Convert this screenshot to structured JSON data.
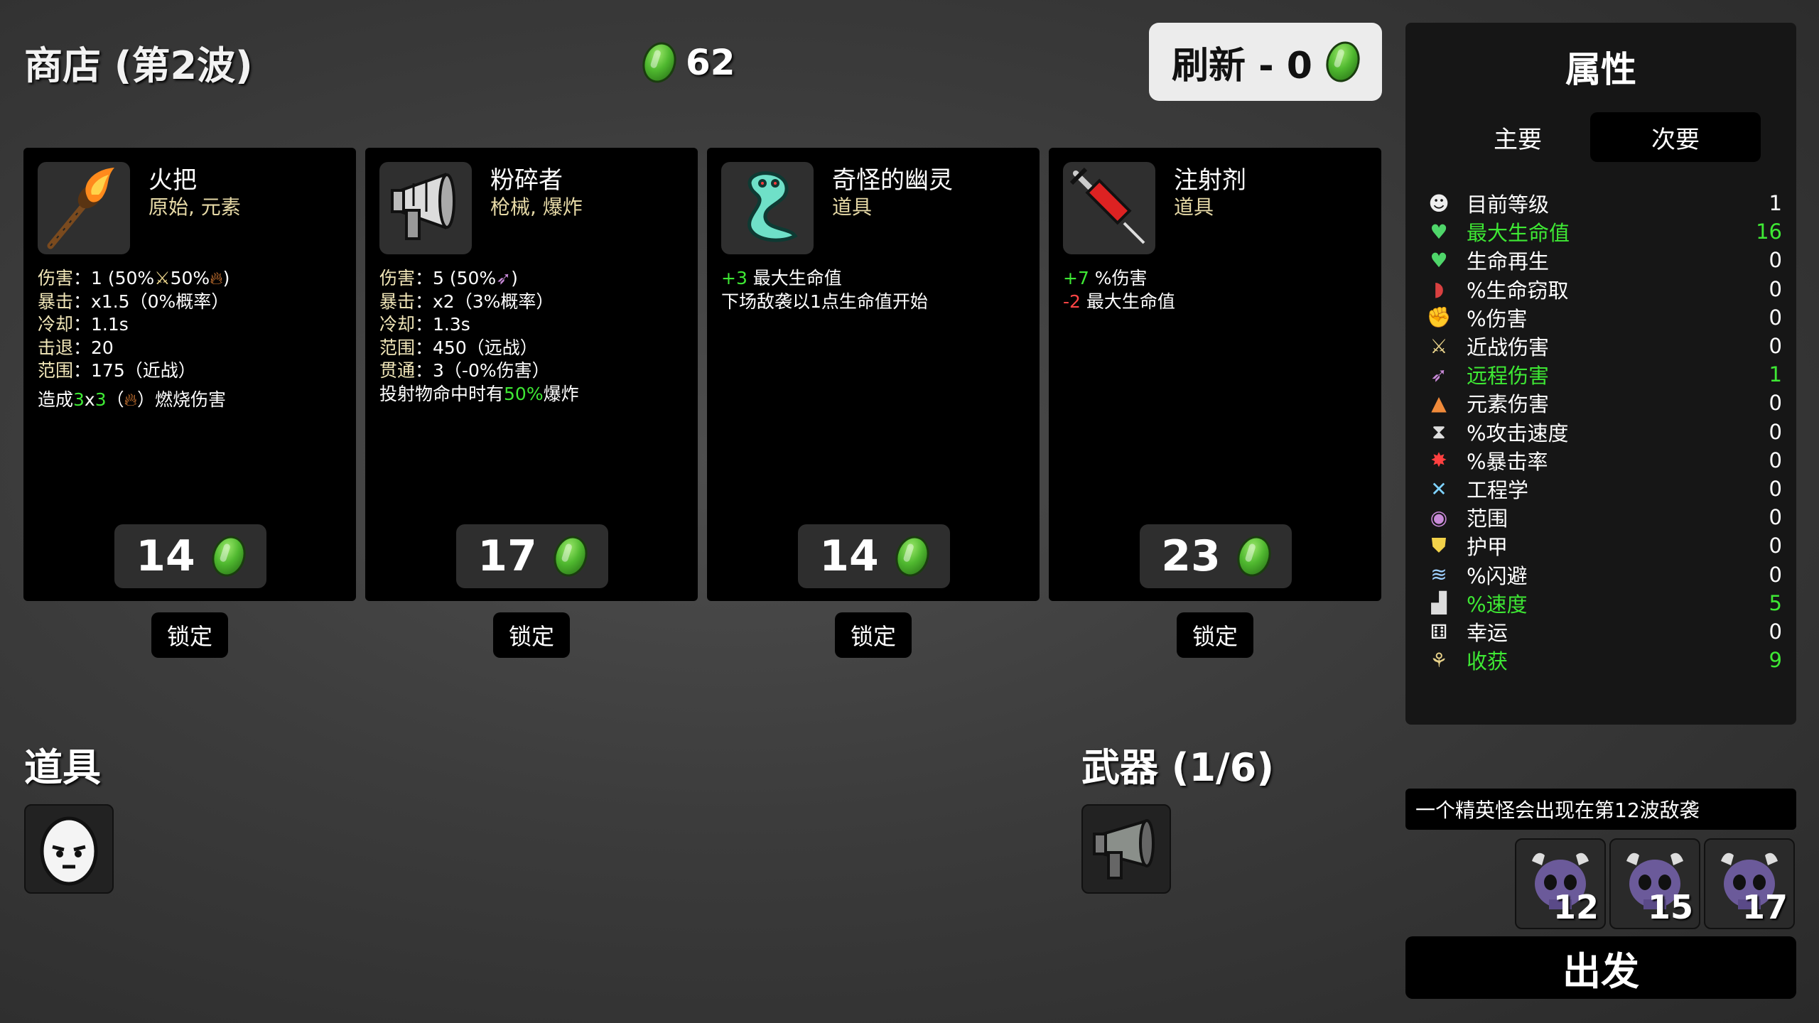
{
  "shop": {
    "title": "商店 (第2波)",
    "materials": "62",
    "reroll_label": "刷新 - 0"
  },
  "cards": [
    {
      "name": "火把",
      "tags": "原始, 元素",
      "price": "14",
      "lock": "锁定",
      "stats": [
        {
          "key": "伤害",
          "text": "：1 (50%",
          "suffix": "50%",
          "end": ")"
        },
        {
          "key": "暴击",
          "text": "：x1.5（0%概率）"
        },
        {
          "key": "冷却",
          "text": "：1.1s"
        },
        {
          "key": "击退",
          "text": "：20"
        },
        {
          "key": "范围",
          "text": "：175（近战）"
        }
      ],
      "effect": {
        "pre": "造成",
        "green1": "3",
        "x": "x",
        "green2": "3",
        "mid": "（",
        "post": "）燃烧伤害"
      }
    },
    {
      "name": "粉碎者",
      "tags": "枪械, 爆炸",
      "price": "17",
      "lock": "锁定",
      "stats": [
        {
          "key": "伤害",
          "text": "：5 (50%",
          "end": ")"
        },
        {
          "key": "暴击",
          "text": "：x2（3%概率）"
        },
        {
          "key": "冷却",
          "text": "：1.3s"
        },
        {
          "key": "范围",
          "text": "：450（远战）"
        },
        {
          "key": "贯通",
          "text": "：3（-0%伤害）"
        }
      ],
      "effect": {
        "pre": "投射物命中时有",
        "green": "50%",
        "post": "爆炸"
      }
    },
    {
      "name": "奇怪的幽灵",
      "tags": "道具",
      "price": "14",
      "lock": "锁定",
      "lines": [
        {
          "sign": "+3",
          "text": " 最大生命值"
        },
        {
          "sign": "",
          "text": "下场敌袭以1点生命值开始"
        }
      ]
    },
    {
      "name": "注射剂",
      "tags": "道具",
      "price": "23",
      "lock": "锁定",
      "lines": [
        {
          "sign": "+7",
          "text": " %伤害"
        },
        {
          "sign": "-2",
          "text": " 最大生命值"
        }
      ]
    }
  ],
  "items_section": {
    "title": "道具"
  },
  "weapons_section": {
    "title": "武器 (1/6)"
  },
  "stats_panel": {
    "title": "属性",
    "tabs": [
      "主要",
      "次要"
    ],
    "rows": [
      {
        "icon": "level-icon",
        "label": "目前等级",
        "value": "1",
        "highlight": false
      },
      {
        "icon": "heart-icon",
        "label": "最大生命值",
        "value": "16",
        "highlight": true
      },
      {
        "icon": "heart-plus-icon",
        "label": "生命再生",
        "value": "0",
        "highlight": false
      },
      {
        "icon": "fang-icon",
        "label": "%生命窃取",
        "value": "0",
        "highlight": false
      },
      {
        "icon": "muscle-icon",
        "label": "%伤害",
        "value": "0",
        "highlight": false
      },
      {
        "icon": "sword-icon",
        "label": "近战伤害",
        "value": "0",
        "highlight": false
      },
      {
        "icon": "bow-icon",
        "label": "远程伤害",
        "value": "1",
        "highlight": true
      },
      {
        "icon": "flame-icon",
        "label": "元素伤害",
        "value": "0",
        "highlight": false
      },
      {
        "icon": "hourglass-icon",
        "label": "%攻击速度",
        "value": "0",
        "highlight": false
      },
      {
        "icon": "crit-icon",
        "label": "%暴击率",
        "value": "0",
        "highlight": false
      },
      {
        "icon": "wrench-icon",
        "label": "工程学",
        "value": "0",
        "highlight": false
      },
      {
        "icon": "range-icon",
        "label": "范围",
        "value": "0",
        "highlight": false
      },
      {
        "icon": "shield-icon",
        "label": "护甲",
        "value": "0",
        "highlight": false
      },
      {
        "icon": "dodge-icon",
        "label": "%闪避",
        "value": "0",
        "highlight": false
      },
      {
        "icon": "boot-icon",
        "label": "%速度",
        "value": "5",
        "highlight": true
      },
      {
        "icon": "dice-icon",
        "label": "幸运",
        "value": "0",
        "highlight": false
      },
      {
        "icon": "harvest-icon",
        "label": "收获",
        "value": "9",
        "highlight": true
      }
    ]
  },
  "elite_notice": "一个精英怪会出现在第12波敌袭",
  "danger_waves": [
    "12",
    "15",
    "17"
  ],
  "go_label": "出发",
  "colors": {
    "highlight": "#3ee834",
    "card_bg": "#000000",
    "tag": "#e6d9a6"
  }
}
